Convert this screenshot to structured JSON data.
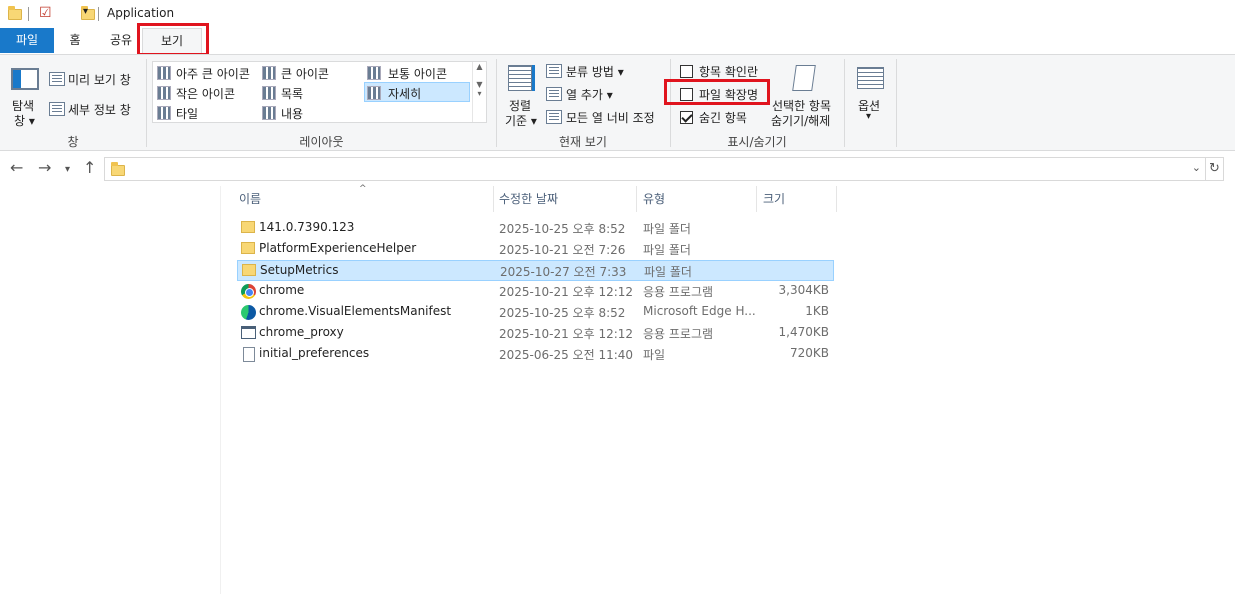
{
  "window": {
    "title": "Application"
  },
  "tabs": {
    "file": "파일",
    "home": "홈",
    "share": "공유",
    "view": "보기"
  },
  "ribbon": {
    "pane": {
      "nav_pane_line1": "탐색",
      "nav_pane_line2": "창",
      "preview": "미리 보기 창",
      "details": "세부 정보 창",
      "group_label": "창"
    },
    "layout": {
      "items": [
        "아주 큰 아이콘",
        "큰 아이콘",
        "보통 아이콘",
        "작은 아이콘",
        "목록",
        "자세히",
        "타일",
        "내용"
      ],
      "group_label": "레이아웃"
    },
    "current_view": {
      "sort_line1": "정렬",
      "sort_line2": "기준",
      "group_by": "분류 방법",
      "add_column": "열 추가",
      "fit_columns": "모든 열 너비 조정",
      "group_label": "현재 보기"
    },
    "show_hide": {
      "item_checkboxes": "항목 확인란",
      "file_extensions": "파일 확장명",
      "hidden_items": "숨긴 항목",
      "hide_selected_line1": "선택한 항목",
      "hide_selected_line2": "숨기기/해제",
      "group_label": "표시/숨기기",
      "item_checkboxes_checked": false,
      "file_extensions_checked": false,
      "hidden_items_checked": true
    },
    "options": {
      "label": "옵션"
    }
  },
  "columns": {
    "name": "이름",
    "date": "수정한 날짜",
    "type": "유형",
    "size": "크기"
  },
  "files": [
    {
      "name": "141.0.7390.123",
      "date": "2025-10-25 오후 8:52",
      "type": "파일 폴더",
      "size": "",
      "icon": "folder-icon",
      "selected": false
    },
    {
      "name": "PlatformExperienceHelper",
      "date": "2025-10-21 오전 7:26",
      "type": "파일 폴더",
      "size": "",
      "icon": "folder-icon",
      "selected": false
    },
    {
      "name": "SetupMetrics",
      "date": "2025-10-27 오전 7:33",
      "type": "파일 폴더",
      "size": "",
      "icon": "folder-icon",
      "selected": true
    },
    {
      "name": "chrome",
      "date": "2025-10-21 오후 12:12",
      "type": "응용 프로그램",
      "size": "3,304KB",
      "icon": "chrome-icon",
      "selected": false
    },
    {
      "name": "chrome.VisualElementsManifest",
      "date": "2025-10-25 오후 8:52",
      "type": "Microsoft Edge H...",
      "size": "1KB",
      "icon": "edge-icon",
      "selected": false
    },
    {
      "name": "chrome_proxy",
      "date": "2025-10-21 오후 12:12",
      "type": "응용 프로그램",
      "size": "1,470KB",
      "icon": "app-icon",
      "selected": false
    },
    {
      "name": "initial_preferences",
      "date": "2025-06-25 오전 11:40",
      "type": "파일",
      "size": "720KB",
      "icon": "file-icon",
      "selected": false
    }
  ],
  "colors": {
    "accent": "#1979ca",
    "selection": "#cce8ff",
    "highlight_box": "#e0141e"
  }
}
